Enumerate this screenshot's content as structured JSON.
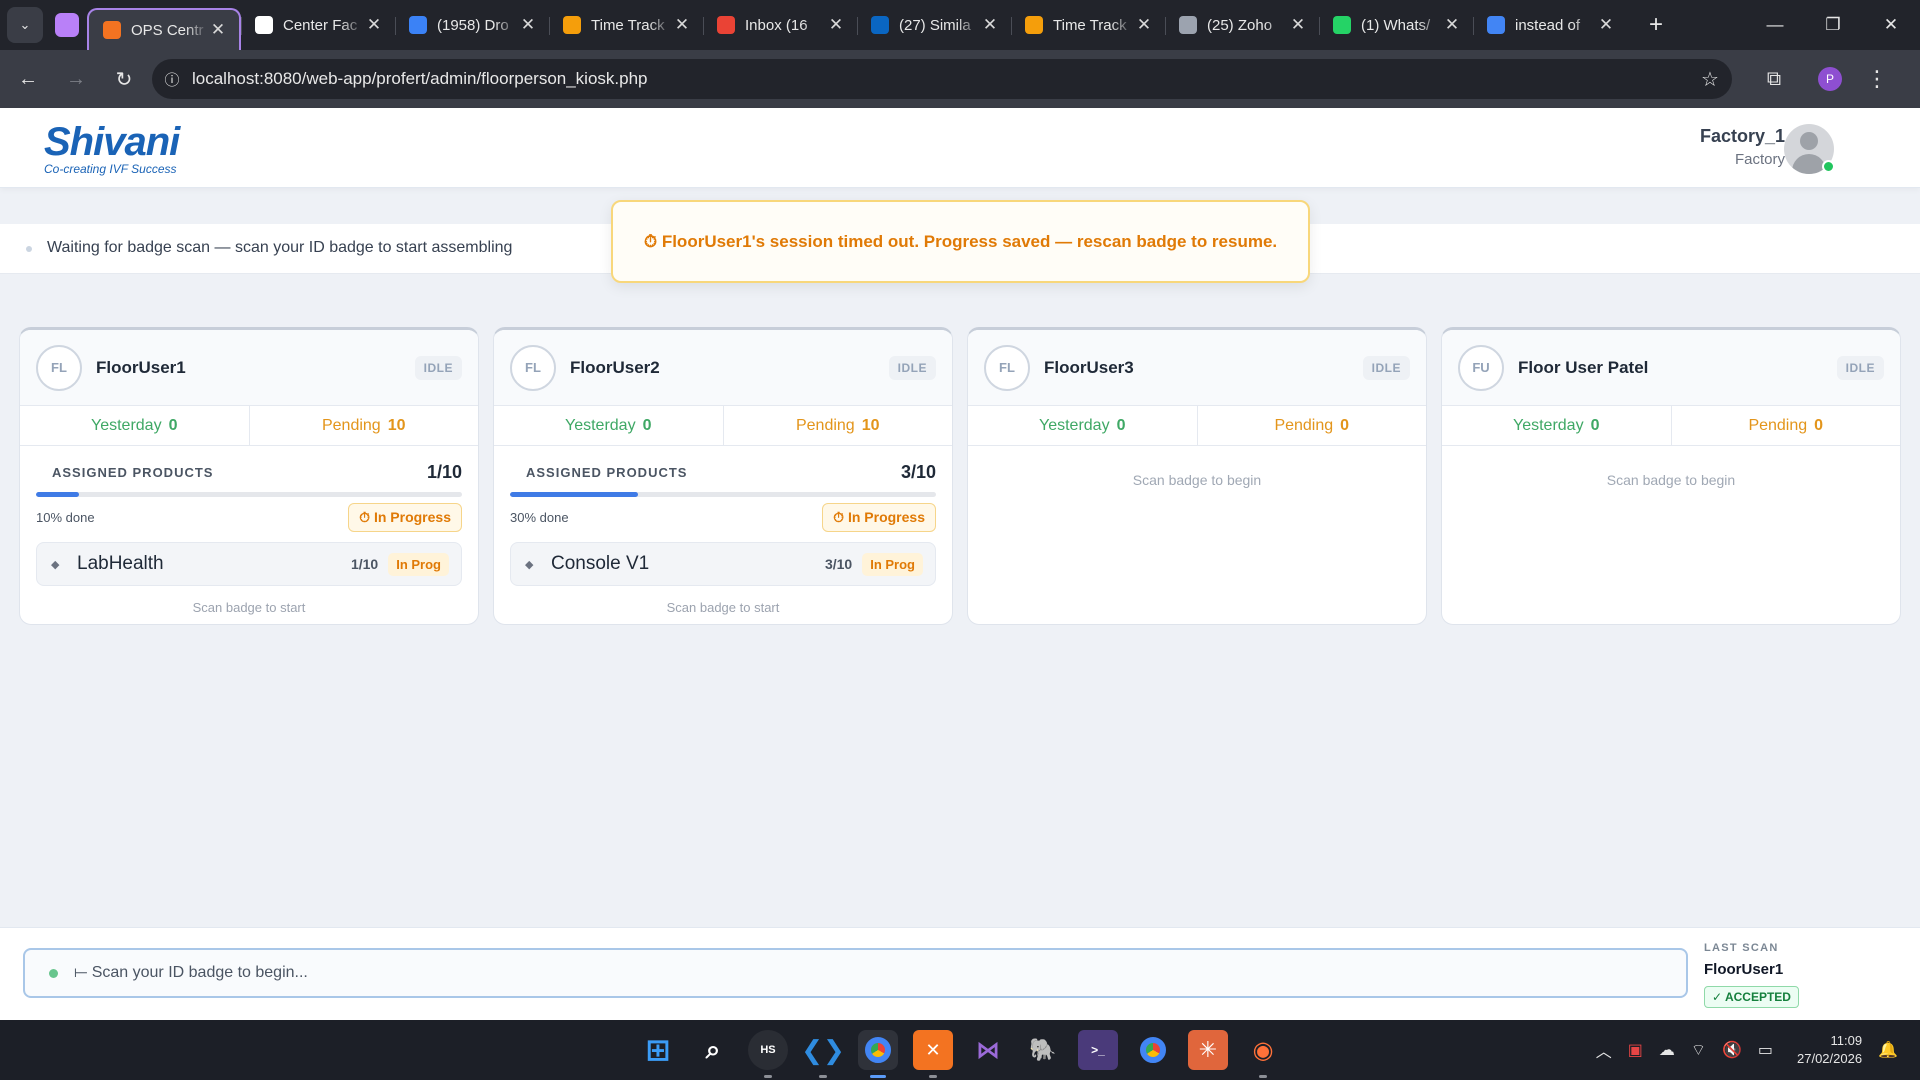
{
  "browser": {
    "tabs": [
      {
        "title": "OPS Centr",
        "favicon": "xampp-icon",
        "color": "#f37321",
        "active": true
      },
      {
        "title": "Center Fac",
        "favicon": "chatgpt-icon",
        "color": "#ffffff",
        "active": false
      },
      {
        "title": "(1958) Dro",
        "favicon": "c-logo-icon",
        "color": "#3b82f6",
        "active": false
      },
      {
        "title": "Time Track",
        "favicon": "diamond-icon",
        "color": "#f59e0b",
        "active": false
      },
      {
        "title": "Inbox (16",
        "favicon": "gmail-icon",
        "color": "#ea4335",
        "active": false
      },
      {
        "title": "(27) Simila",
        "favicon": "linkedin-icon",
        "color": "#0a66c2",
        "active": false
      },
      {
        "title": "Time Track",
        "favicon": "diamond-icon",
        "color": "#f59e0b",
        "active": false
      },
      {
        "title": "(25) Zoho",
        "favicon": "zoho-icon",
        "color": "#9ca3af",
        "active": false
      },
      {
        "title": "(1) Whats/",
        "favicon": "whatsapp-icon",
        "color": "#25d366",
        "active": false
      },
      {
        "title": "instead of",
        "favicon": "google-icon",
        "color": "#4285f4",
        "active": false
      }
    ],
    "url": "localhost:8080/web-app/profert/admin/floorperson_kiosk.php",
    "profile_initial": "P"
  },
  "header": {
    "brand": "Shivani",
    "tagline": "Co-creating IVF Success",
    "user_name": "Factory_1",
    "user_role": "Factory"
  },
  "status": {
    "waiting_text": "Waiting for badge scan — scan your ID badge to start assembling"
  },
  "toast": {
    "message": "⏱ FloorUser1's session timed out. Progress saved — rescan badge to resume."
  },
  "labels": {
    "yesterday": "Yesterday",
    "pending": "Pending",
    "assigned_products": "ASSIGNED PRODUCTS",
    "in_progress": "⏱ In Progress",
    "scan_to_start": "Scan badge to start",
    "scan_to_begin": "Scan badge to begin"
  },
  "cards": [
    {
      "initials": "FL",
      "name": "FloorUser1",
      "state": "IDLE",
      "yesterday": "0",
      "pending": "10",
      "assigned_count": "1/10",
      "progress": 0.1,
      "percent_text": "10% done",
      "product": {
        "name": "LabHealth",
        "count": "1/10",
        "status": "In Prog"
      }
    },
    {
      "initials": "FL",
      "name": "FloorUser2",
      "state": "IDLE",
      "yesterday": "0",
      "pending": "10",
      "assigned_count": "3/10",
      "progress": 0.3,
      "percent_text": "30% done",
      "product": {
        "name": "Console V1",
        "count": "3/10",
        "status": "In Prog"
      }
    },
    {
      "initials": "FL",
      "name": "FloorUser3",
      "state": "IDLE",
      "yesterday": "0",
      "pending": "0"
    },
    {
      "initials": "FU",
      "name": "Floor User Patel",
      "state": "IDLE",
      "yesterday": "0",
      "pending": "0"
    }
  ],
  "scanbar": {
    "placeholder": "⟝ Scan your ID badge to begin...",
    "last_scan_label": "LAST SCAN",
    "last_scan_name": "FloorUser1",
    "last_scan_status": "✓ ACCEPTED"
  },
  "taskbar": {
    "time": "11:09",
    "date": "27/02/2026"
  }
}
